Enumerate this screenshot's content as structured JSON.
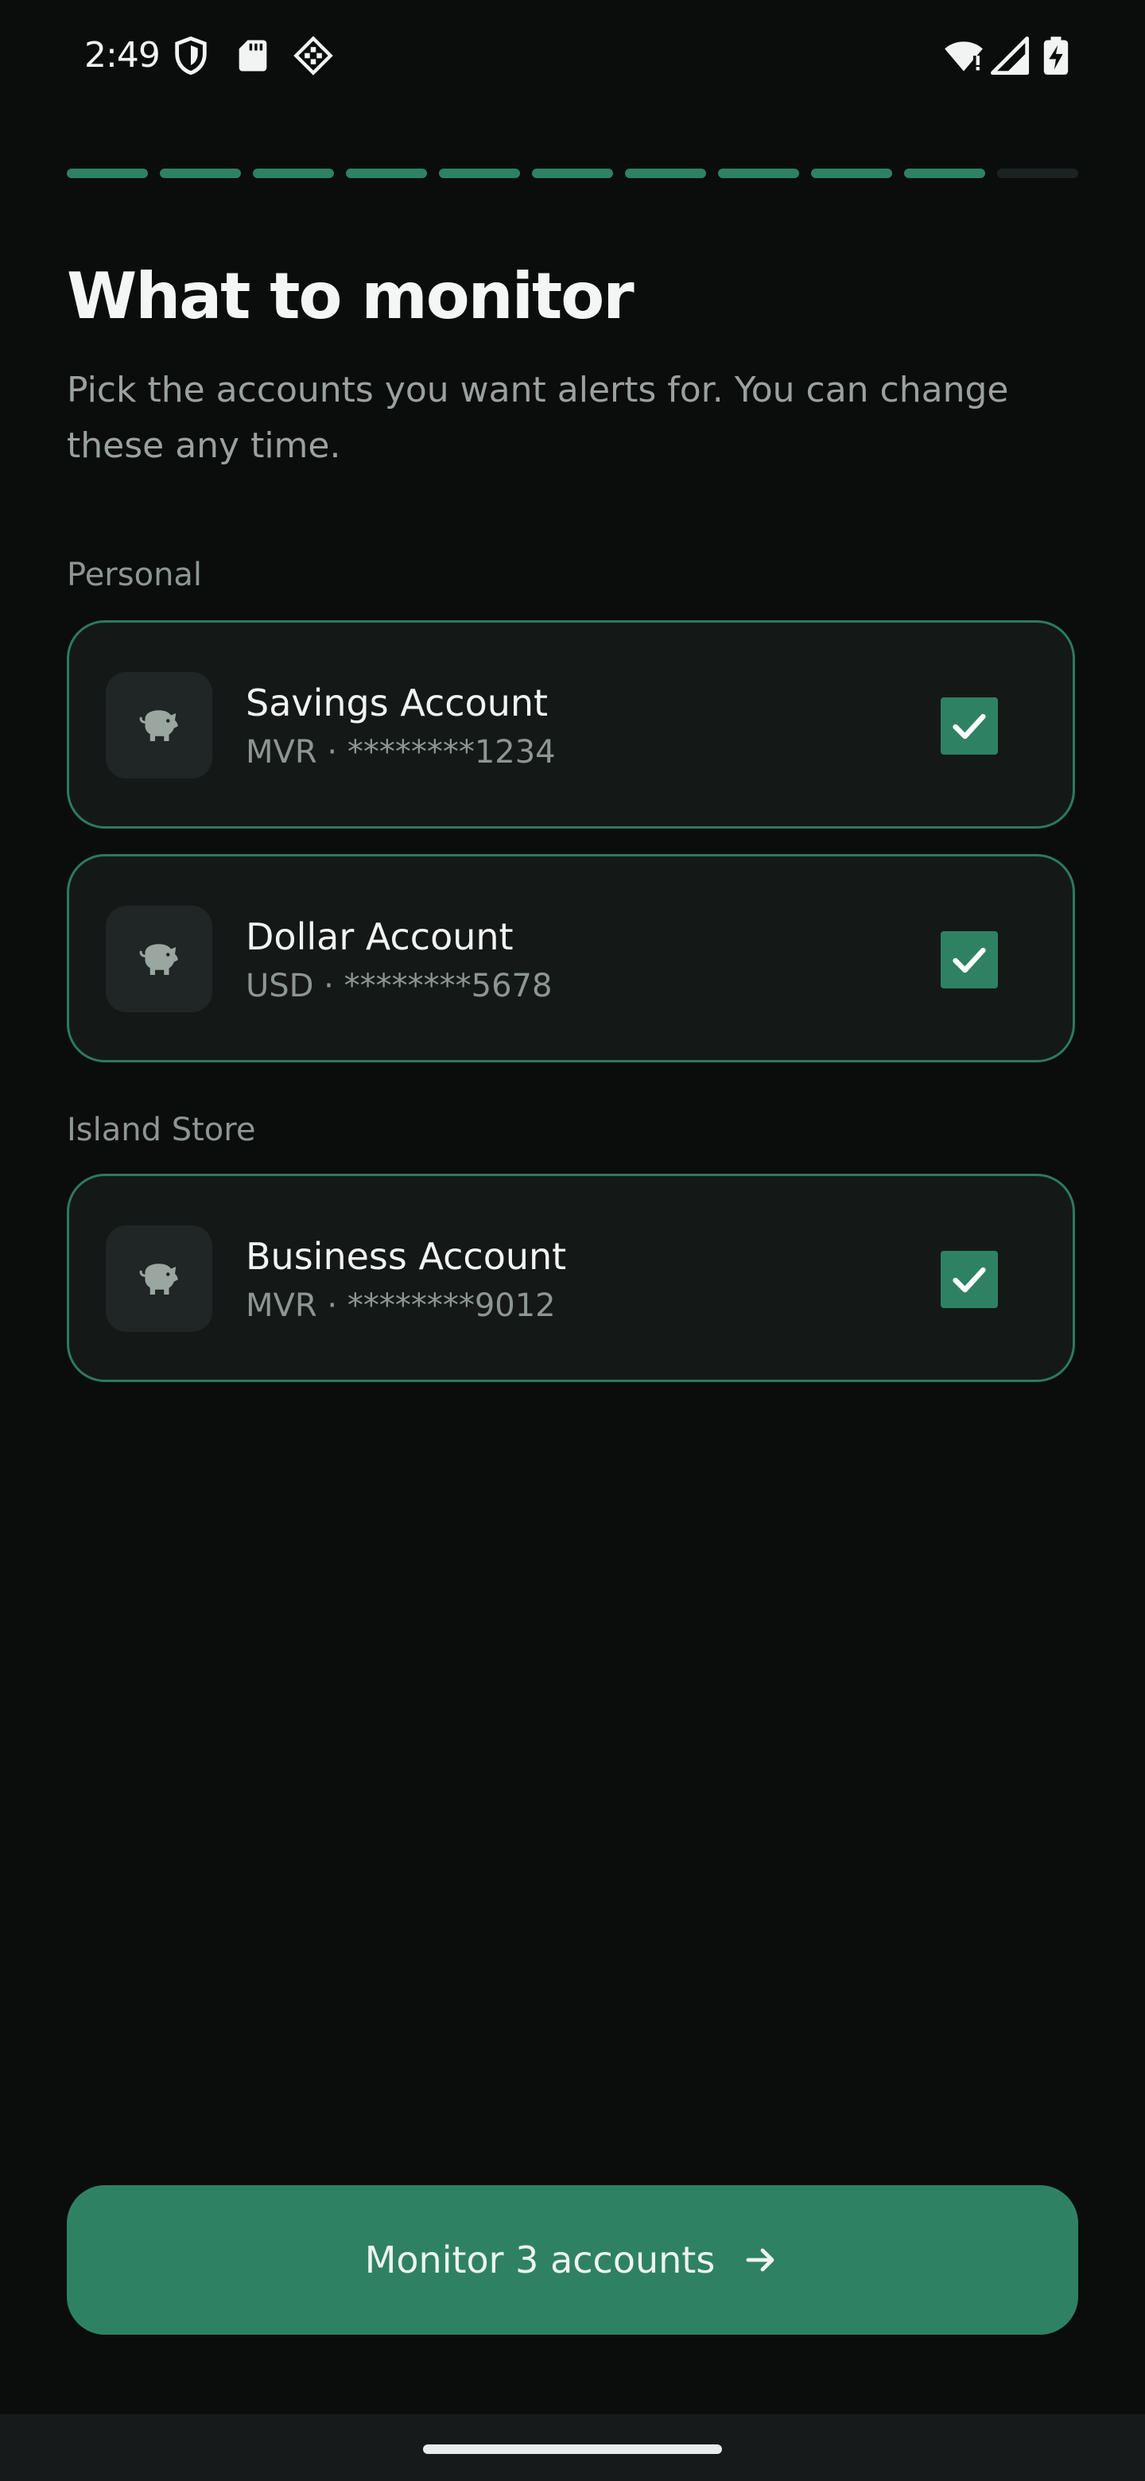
{
  "status_bar": {
    "time": "2:49",
    "left_icons": [
      "shield-icon",
      "sd-card-icon",
      "game-controller-icon"
    ],
    "right_icons": [
      "wifi-icon",
      "cell-signal-icon",
      "battery-charging-icon"
    ]
  },
  "progress": {
    "total_steps": 11,
    "completed_steps": 10,
    "accent_color": "#2e8263"
  },
  "header": {
    "title": "What to monitor",
    "subtitle": "Pick the accounts you want alerts for. You can change these any time."
  },
  "sections": [
    {
      "label": "Personal",
      "accounts": [
        {
          "name": "Savings Account",
          "currency": "MVR",
          "masked_number": "********1234",
          "meta": "MVR · ********1234",
          "checked": true,
          "icon": "piggy-bank-icon"
        },
        {
          "name": "Dollar Account",
          "currency": "USD",
          "masked_number": "********5678",
          "meta": "USD · ********5678",
          "checked": true,
          "icon": "piggy-bank-icon"
        }
      ]
    },
    {
      "label": "Island Store",
      "accounts": [
        {
          "name": "Business Account",
          "currency": "MVR",
          "masked_number": "********9012",
          "meta": "MVR · ********9012",
          "checked": true,
          "icon": "piggy-bank-icon"
        }
      ]
    }
  ],
  "cta": {
    "label": "Monitor 3 accounts",
    "icon": "arrow-right-icon"
  },
  "colors": {
    "background": "#0b0d0d",
    "card_border": "#2c7a5c",
    "accent": "#2e8263"
  }
}
